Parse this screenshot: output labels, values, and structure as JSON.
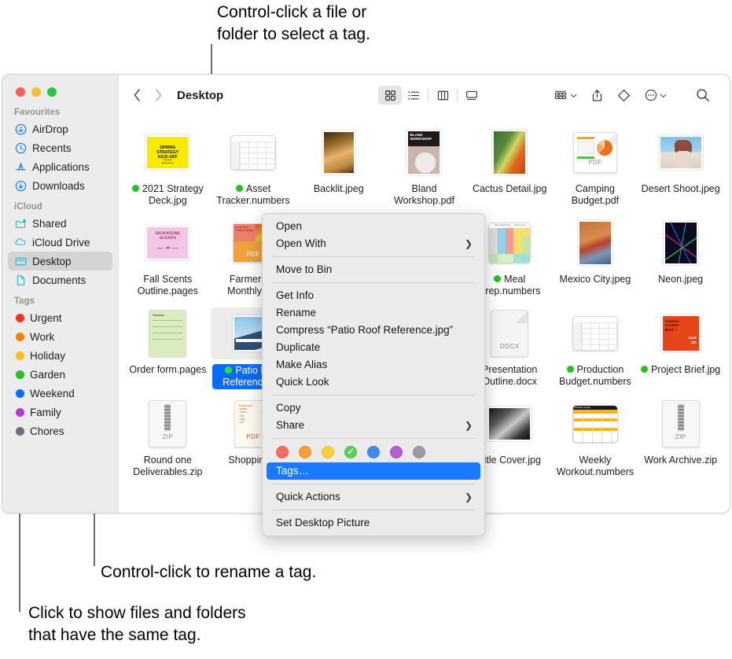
{
  "callouts": {
    "top": "Control-click a file or\nfolder to select a tag.",
    "middle": "Control-click to rename a tag.",
    "bottom": "Click to show files and folders\nthat have the same tag."
  },
  "window": {
    "traffic_lights": {
      "close": "#ff5f57",
      "minimize": "#febc2e",
      "maximize": "#28c840"
    }
  },
  "toolbar": {
    "back_icon": "chevron-left-icon",
    "forward_icon": "chevron-right-icon",
    "title": "Desktop",
    "views": [
      {
        "name": "icon-view",
        "icon": "grid-icon",
        "active": true
      },
      {
        "name": "list-view",
        "icon": "list-icon",
        "active": false
      },
      {
        "name": "column-view",
        "icon": "columns-icon",
        "active": false
      },
      {
        "name": "gallery-view",
        "icon": "gallery-icon",
        "active": false
      }
    ],
    "group_by": {
      "name": "group-by-button",
      "icon": "group-icon"
    },
    "share": {
      "name": "share-button",
      "icon": "share-icon"
    },
    "tags": {
      "name": "tags-button",
      "icon": "tag-icon"
    },
    "more": {
      "name": "more-button",
      "icon": "ellipsis-icon"
    },
    "search": {
      "name": "search-button",
      "icon": "search-icon"
    }
  },
  "sidebar": {
    "sections": [
      {
        "title": "Favourites",
        "items": [
          {
            "label": "AirDrop",
            "icon": "airdrop-icon",
            "selected": false
          },
          {
            "label": "Recents",
            "icon": "clock-icon",
            "selected": false
          },
          {
            "label": "Applications",
            "icon": "applications-icon",
            "selected": false
          },
          {
            "label": "Downloads",
            "icon": "download-icon",
            "selected": false
          }
        ]
      },
      {
        "title": "iCloud",
        "items": [
          {
            "label": "Shared",
            "icon": "shared-folder-icon",
            "selected": false
          },
          {
            "label": "iCloud Drive",
            "icon": "cloud-icon",
            "selected": false
          },
          {
            "label": "Desktop",
            "icon": "desktop-icon",
            "selected": true
          },
          {
            "label": "Documents",
            "icon": "document-icon",
            "selected": false
          }
        ]
      }
    ],
    "tags_section": {
      "title": "Tags",
      "items": [
        {
          "label": "Urgent",
          "color": "#ff2d21"
        },
        {
          "label": "Work",
          "color": "#f87d09"
        },
        {
          "label": "Holiday",
          "color": "#fcbd1c"
        },
        {
          "label": "Garden",
          "color": "#22c322"
        },
        {
          "label": "Weekend",
          "color": "#0a6cff"
        },
        {
          "label": "Family",
          "color": "#b53bd6"
        },
        {
          "label": "Chores",
          "color": "#70707a"
        }
      ]
    }
  },
  "files": [
    {
      "name": "2021 Strategy Deck.jpg",
      "kind": "photo-yellow",
      "tag": "#22c322",
      "selected": false
    },
    {
      "name": "Asset Tracker.numbers",
      "kind": "numbers",
      "tag": "#22c322",
      "selected": false
    },
    {
      "name": "Backlit.jpeg",
      "kind": "photo-backlit",
      "tag": null,
      "selected": false
    },
    {
      "name": "Bland Workshop.pdf",
      "kind": "photo-bland",
      "tag": null,
      "selected": false
    },
    {
      "name": "Cactus Detail.jpg",
      "kind": "photo-cactus",
      "tag": null,
      "selected": false
    },
    {
      "name": "Camping Budget.pdf",
      "kind": "pdf-chart",
      "tag": null,
      "selected": false
    },
    {
      "name": "Desert Shoot.jpeg",
      "kind": "photo-desert",
      "tag": null,
      "selected": false
    },
    {
      "name": "Fall Scents Outline.pages",
      "kind": "pages-pink",
      "tag": null,
      "selected": false
    },
    {
      "name": "Farmers M Monthly...ck",
      "kind": "pdf-market",
      "tag": null,
      "selected": false
    },
    {
      "name": "",
      "kind": "blank",
      "tag": null,
      "selected": false
    },
    {
      "name": "",
      "kind": "blank",
      "tag": null,
      "selected": false
    },
    {
      "name": "Meal Prep.numbers",
      "kind": "numbers-color",
      "tag": "#22c322",
      "selected": false
    },
    {
      "name": "Mexico City.jpeg",
      "kind": "photo-mexico",
      "tag": null,
      "selected": false
    },
    {
      "name": "Neon.jpeg",
      "kind": "photo-neon",
      "tag": null,
      "selected": false
    },
    {
      "name": "Order form.pages",
      "kind": "pages-green",
      "tag": null,
      "selected": false
    },
    {
      "name": "Patio Roof Reference.jpg",
      "kind": "photo-patio",
      "tag": "#22c322",
      "selected": true
    },
    {
      "name": "",
      "kind": "blank",
      "tag": null,
      "selected": false
    },
    {
      "name": "",
      "kind": "blank",
      "tag": null,
      "selected": false
    },
    {
      "name": "Presentation Outline.docx",
      "kind": "docx",
      "tag": null,
      "selected": false
    },
    {
      "name": "Production Budget.numbers",
      "kind": "numbers",
      "tag": "#22c322",
      "selected": false
    },
    {
      "name": "Project Brief.jpg",
      "kind": "photo-orange",
      "tag": "#22c322",
      "selected": false
    },
    {
      "name": "Round one Deliverables.zip",
      "kind": "zip",
      "tag": null,
      "selected": false
    },
    {
      "name": "Shopping L",
      "kind": "pdf-shopping",
      "tag": null,
      "selected": false
    },
    {
      "name": "",
      "kind": "blank",
      "tag": null,
      "selected": false
    },
    {
      "name": "",
      "kind": "blank",
      "tag": null,
      "selected": false
    },
    {
      "name": "Title Cover.jpg",
      "kind": "photo-bw",
      "tag": null,
      "selected": false
    },
    {
      "name": "Weekly Workout.numbers",
      "kind": "numbers-workout",
      "tag": null,
      "selected": false
    },
    {
      "name": "Work Archive.zip",
      "kind": "zip",
      "tag": null,
      "selected": false
    }
  ],
  "context_menu": {
    "groups": [
      [
        {
          "label": "Open",
          "submenu": false,
          "highlight": false
        },
        {
          "label": "Open With",
          "submenu": true,
          "highlight": false
        }
      ],
      [
        {
          "label": "Move to Bin",
          "submenu": false,
          "highlight": false
        }
      ],
      [
        {
          "label": "Get Info",
          "submenu": false,
          "highlight": false
        },
        {
          "label": "Rename",
          "submenu": false,
          "highlight": false
        },
        {
          "label": "Compress “Patio Roof Reference.jpg”",
          "submenu": false,
          "highlight": false
        },
        {
          "label": "Duplicate",
          "submenu": false,
          "highlight": false
        },
        {
          "label": "Make Alias",
          "submenu": false,
          "highlight": false
        },
        {
          "label": "Quick Look",
          "submenu": false,
          "highlight": false
        }
      ],
      [
        {
          "label": "Copy",
          "submenu": false,
          "highlight": false
        },
        {
          "label": "Share",
          "submenu": true,
          "highlight": false
        }
      ]
    ],
    "swatches": [
      {
        "name": "tag-swatch-red",
        "color": "#fb6b60",
        "checked": false
      },
      {
        "name": "tag-swatch-orange",
        "color": "#f8a032",
        "checked": false
      },
      {
        "name": "tag-swatch-yellow",
        "color": "#fbd235",
        "checked": false
      },
      {
        "name": "tag-swatch-green",
        "color": "#5cd05c",
        "checked": true
      },
      {
        "name": "tag-swatch-blue",
        "color": "#3f8af5",
        "checked": false
      },
      {
        "name": "tag-swatch-purple",
        "color": "#b05fd6",
        "checked": false
      },
      {
        "name": "tag-swatch-gray",
        "color": "#9a9aa0",
        "checked": false
      }
    ],
    "check_glyph": "✓",
    "tags_item": {
      "label": "Tags…",
      "highlight": true
    },
    "quick_actions": {
      "label": "Quick Actions",
      "submenu": true
    },
    "set_desktop": {
      "label": "Set Desktop Picture",
      "submenu": false
    },
    "submenu_glyph": "❯"
  }
}
